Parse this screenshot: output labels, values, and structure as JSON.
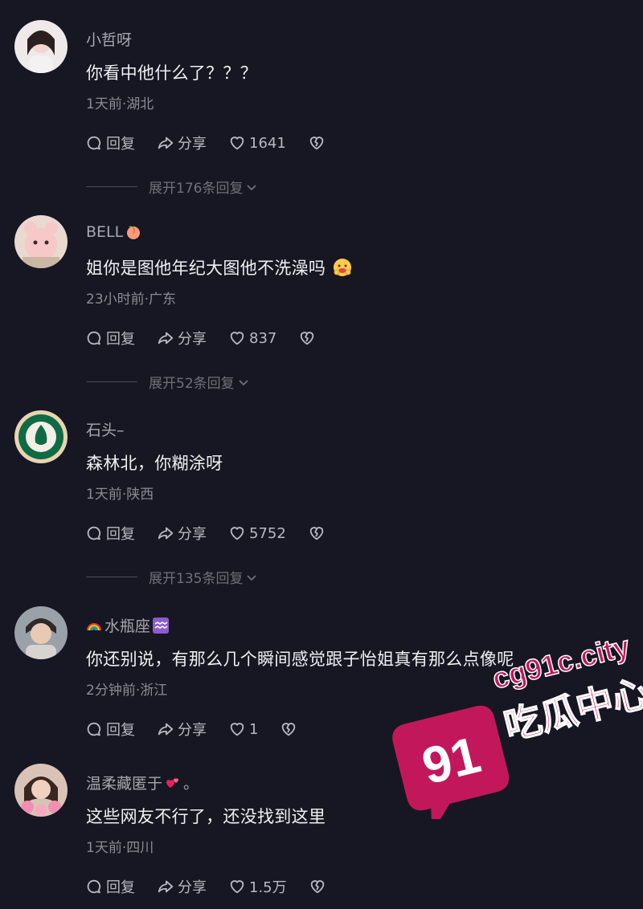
{
  "comments": [
    {
      "user": "小哲呀",
      "text": "你看中他什么了？？？",
      "meta": "1天前·湖北",
      "reply_label": "回复",
      "share_label": "分享",
      "likes": "1641",
      "expand": "展开176条回复"
    },
    {
      "user": "BELL",
      "text": "姐你是图他年纪大图他不洗澡吗",
      "meta": "23小时前·广东",
      "reply_label": "回复",
      "share_label": "分享",
      "likes": "837",
      "expand": "展开52条回复"
    },
    {
      "user": "石头–",
      "text": "森林北，你糊涂呀",
      "meta": "1天前·陕西",
      "reply_label": "回复",
      "share_label": "分享",
      "likes": "5752",
      "expand": "展开135条回复"
    },
    {
      "user": "水瓶座",
      "text": "你还别说，有那么几个瞬间感觉跟子怡姐真有那么点像呢",
      "meta": "2分钟前·浙江",
      "reply_label": "回复",
      "share_label": "分享",
      "likes": "1",
      "expand": ""
    },
    {
      "user": "温柔藏匿于",
      "user_suffix": "。",
      "text": "这些网友不行了，还没找到这里",
      "meta": "1天前·四川",
      "reply_label": "回复",
      "share_label": "分享",
      "likes": "1.5万",
      "expand": ""
    }
  ],
  "watermark": {
    "number": "91",
    "domain": "cg91c.city",
    "name": "吃瓜中心"
  },
  "colors": {
    "background": "#161722",
    "watermark": "#c2185b"
  }
}
